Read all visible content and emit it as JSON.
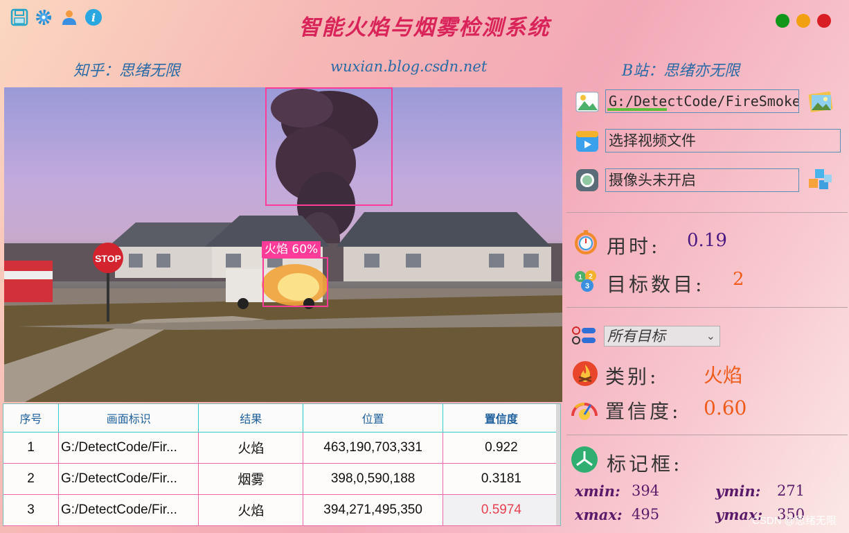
{
  "app": {
    "title": "智能火焰与烟雾检测系统",
    "subtitle_left": "知乎：思绪无限",
    "subtitle_center": "wuxian.blog.csdn.net",
    "subtitle_right": "B站：思绪亦无限"
  },
  "toolbar_icons": [
    "save-icon",
    "settings-icon",
    "user-icon",
    "info-icon"
  ],
  "window_buttons": {
    "colors": [
      "#11961a",
      "#f1a012",
      "#d91d24"
    ]
  },
  "video": {
    "detections": [
      {
        "label": "火焰 60%"
      }
    ]
  },
  "table": {
    "headers": [
      "序号",
      "画面标识",
      "结果",
      "位置",
      "置信度"
    ],
    "rows": [
      {
        "idx": "1",
        "source": "G:/DetectCode/Fir...",
        "result": "火焰",
        "position": "463,190,703,331",
        "confidence": "0.922"
      },
      {
        "idx": "2",
        "source": "G:/DetectCode/Fir...",
        "result": "烟雾",
        "position": "398,0,590,188",
        "confidence": "0.3181"
      },
      {
        "idx": "3",
        "source": "G:/DetectCode/Fir...",
        "result": "火焰",
        "position": "394,271,495,350",
        "confidence": "0.5974"
      }
    ]
  },
  "controls": {
    "image_path": "G:/DetectCode/FireSmoke",
    "image_progress": 0.31,
    "video_field": "选择视频文件",
    "camera_field": "摄像头未开启"
  },
  "stats": {
    "time_label": "用时:",
    "time_value": "0.19",
    "count_label": "目标数目:",
    "count_value": "2"
  },
  "filter": {
    "selected": "所有目标",
    "class_label": "类别:",
    "class_value": "火焰",
    "conf_label": "置信度:",
    "conf_value": "0.60"
  },
  "bbox": {
    "label": "标记框:",
    "xmin_label": "xmin:",
    "xmin": "394",
    "ymin_label": "ymin:",
    "ymin": "271",
    "xmax_label": "xmax:",
    "xmax": "495",
    "ymax_label": "ymax:",
    "ymax": "350"
  },
  "watermark": "CSDN @思绪无限",
  "colors": {
    "accent": "#d9245a",
    "box": "#ff3b9a",
    "value_orange": "#f05a1a"
  }
}
